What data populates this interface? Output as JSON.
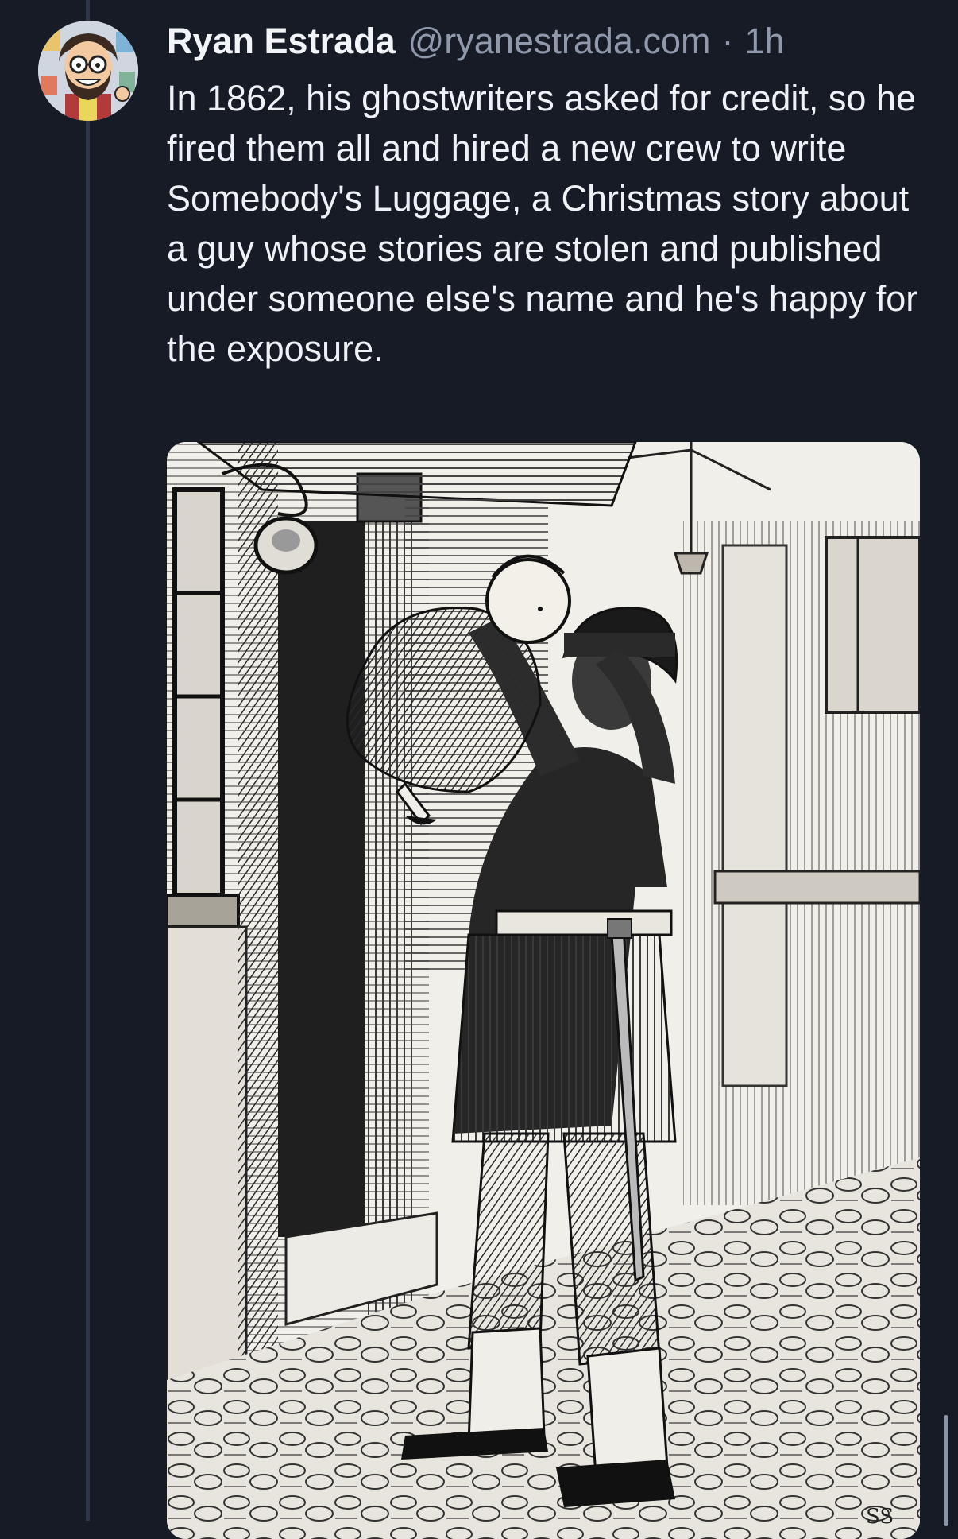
{
  "post": {
    "author_name": "Ryan Estrada",
    "author_handle": "@ryanestrada.com",
    "separator": "·",
    "timestamp": "1h",
    "text": "In 1862, his ghostwriters asked for credit, so he fired them all and hired a new crew to write Somebody's Luggage, a Christmas story about a guy whose stories are stolen and published under someone else's name and he's happy for the exposure.",
    "image_signature": "SS"
  },
  "icons": {
    "avatar": "cartoon-avatar-icon"
  },
  "colors": {
    "background": "#161b26",
    "thread_line": "#2e3647",
    "primary_text": "#eef1f6",
    "secondary_text": "#8f99ab"
  }
}
